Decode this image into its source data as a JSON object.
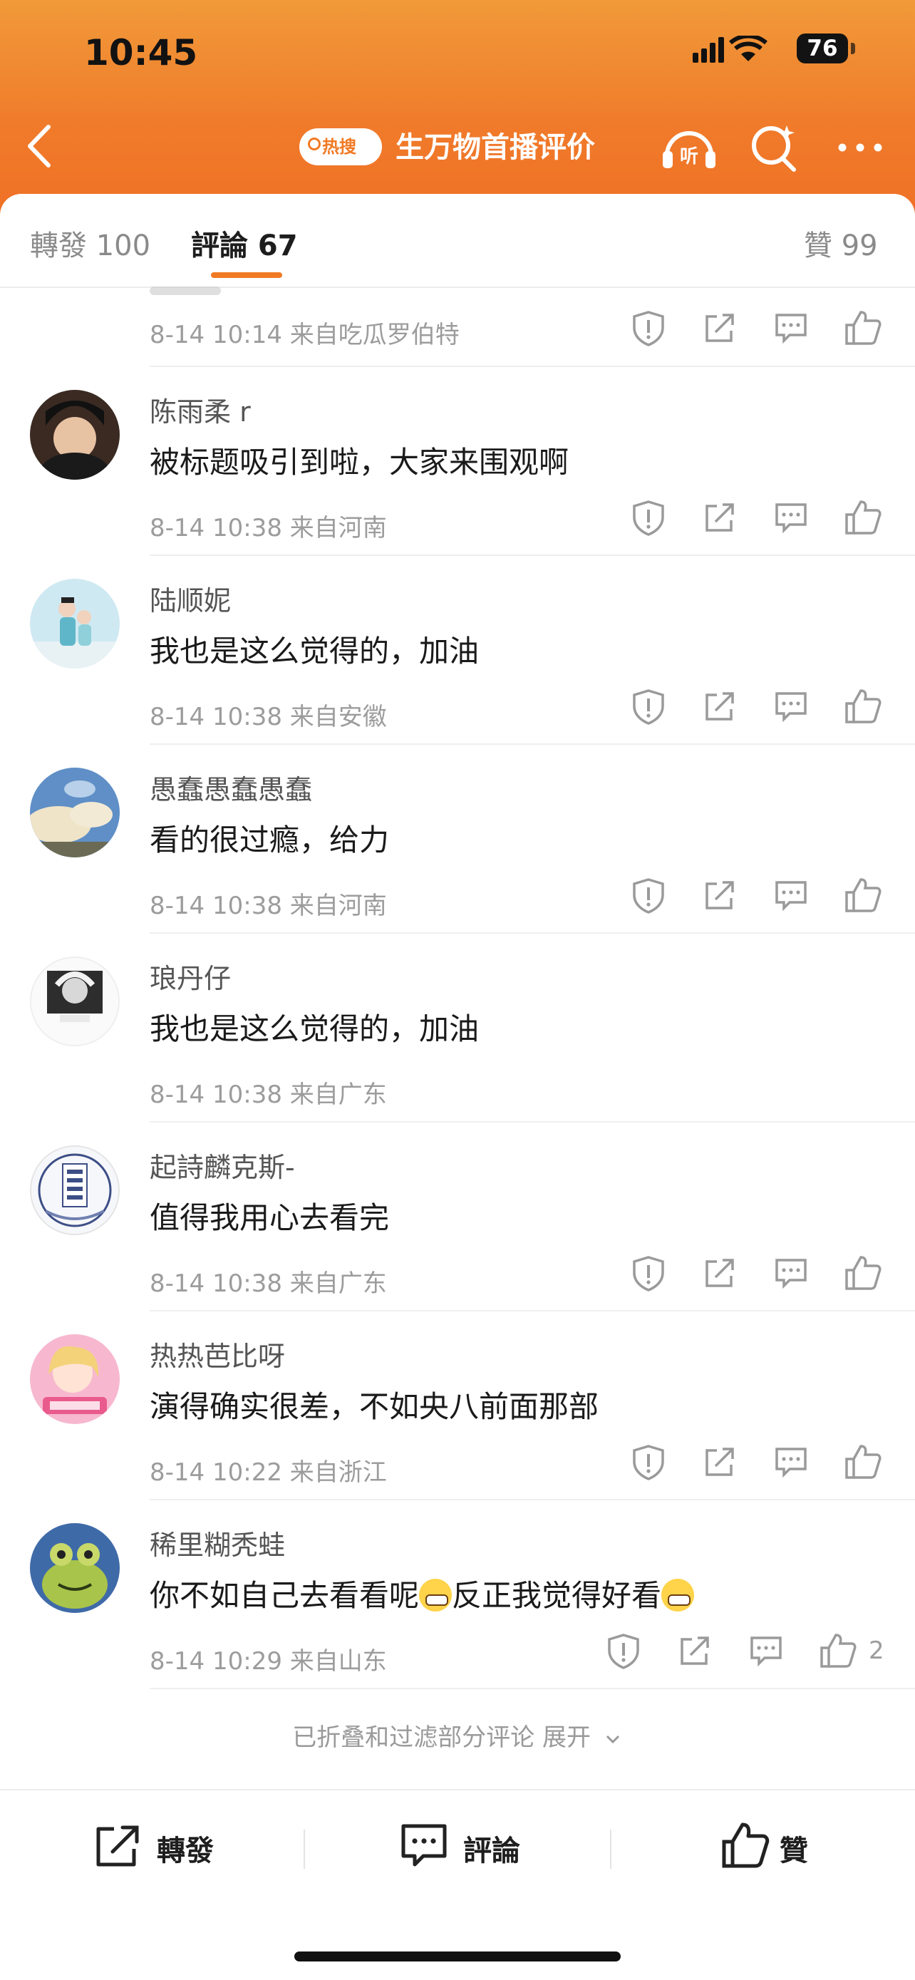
{
  "status": {
    "time": "10:45",
    "battery": "76"
  },
  "nav": {
    "hot_badge": "热搜",
    "title": "生万物首播评价"
  },
  "tabs": {
    "repost": "轉發 100",
    "comment": "評論 67",
    "like": "贊 99"
  },
  "partial_comment": {
    "meta": "8-14 10:14  来自吃瓜罗伯特"
  },
  "comments": [
    {
      "name": "陈雨柔 r",
      "text": "被标题吸引到啦，大家来围观啊",
      "meta": "8-14 10:38  来自河南",
      "avatar": "portrait-avatar"
    },
    {
      "name": "陆顺妮",
      "text": "我也是这么觉得的，加油",
      "meta": "8-14 10:38  来自安徽",
      "avatar": "costume-avatar"
    },
    {
      "name": "愚蠢愚蠢愚蠢",
      "text": "看的很过瘾，给力",
      "meta": "8-14 10:38  来自河南",
      "avatar": "sky-avatar"
    },
    {
      "name": "琅丹仔",
      "text": "我也是这么觉得的，加油",
      "meta": "8-14 10:38  来自广东",
      "avatar": "einstein-avatar"
    },
    {
      "name": "起詩麟克斯-",
      "text": "值得我用心去看完",
      "meta": "8-14 10:38  来自广东",
      "avatar": "book-avatar"
    },
    {
      "name": "热热芭比呀",
      "text": "演得确实很差，不如央八前面那部",
      "meta": "8-14 10:22  来自浙江",
      "avatar": "cartoon-girl-avatar"
    },
    {
      "name": "稀里糊秃蛙",
      "text_a": "你不如自己去看看呢",
      "text_b": "反正我觉得好看",
      "meta": "8-14 10:29  来自山东",
      "like_count": "2",
      "avatar": "frog-avatar"
    }
  ],
  "fold_text": "已折叠和过滤部分评论 展开",
  "bottom": {
    "repost": "轉發",
    "comment": "評論",
    "like": "贊"
  },
  "colors": {
    "accent": "#f07a24"
  }
}
